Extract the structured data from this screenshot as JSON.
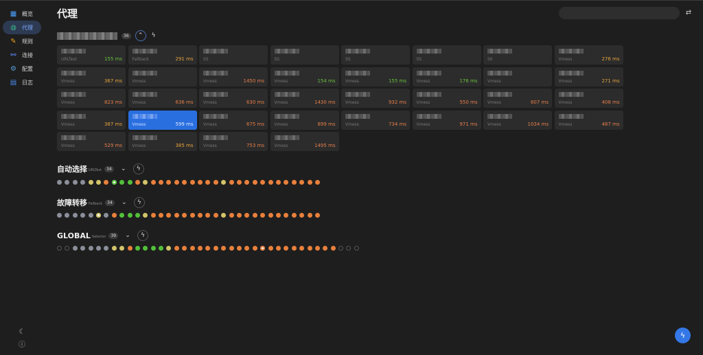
{
  "sidebar": {
    "items": [
      {
        "label": "概览",
        "icon": "chart-icon",
        "glyph": "▦",
        "color": "#4aa3ff"
      },
      {
        "label": "代理",
        "icon": "globe-icon",
        "glyph": "◍",
        "color": "#3bb58a",
        "active": true
      },
      {
        "label": "规则",
        "icon": "pencil-icon",
        "glyph": "✎",
        "color": "#f0a020"
      },
      {
        "label": "连接",
        "icon": "link-icon",
        "glyph": "⚯",
        "color": "#5b8dff"
      },
      {
        "label": "配置",
        "icon": "gear-icon",
        "glyph": "⚙",
        "color": "#5aa0d8"
      },
      {
        "label": "日志",
        "icon": "document-icon",
        "glyph": "▤",
        "color": "#4a8cf0"
      }
    ],
    "theme_glyph": "☾",
    "about_glyph": "ⓘ"
  },
  "header": {
    "title": "代理",
    "settings_glyph": "⇄"
  },
  "main_group": {
    "count": "36",
    "collapse_glyph": "⌃",
    "test_glyph": "ϟ",
    "proxies": [
      {
        "type": "URLTest",
        "delay": "155 ms",
        "tone": "green"
      },
      {
        "type": "Fallback",
        "delay": "291 ms",
        "tone": "orange"
      },
      {
        "type": "SS",
        "delay": "",
        "tone": ""
      },
      {
        "type": "SS",
        "delay": "",
        "tone": ""
      },
      {
        "type": "SS",
        "delay": "",
        "tone": ""
      },
      {
        "type": "SS",
        "delay": "",
        "tone": ""
      },
      {
        "type": "SS",
        "delay": "",
        "tone": ""
      },
      {
        "type": "Vmess",
        "delay": "276 ms",
        "tone": "orange"
      },
      {
        "type": "Vmess",
        "delay": "367 ms",
        "tone": "orange"
      },
      {
        "type": "Vmess",
        "delay": "",
        "tone": ""
      },
      {
        "type": "Vmess",
        "delay": "1450 ms",
        "tone": "red"
      },
      {
        "type": "Vmess",
        "delay": "154 ms",
        "tone": "green"
      },
      {
        "type": "Vmess",
        "delay": "155 ms",
        "tone": "green"
      },
      {
        "type": "Vmess",
        "delay": "176 ms",
        "tone": "green"
      },
      {
        "type": "Vmess",
        "delay": "",
        "tone": ""
      },
      {
        "type": "Vmess",
        "delay": "271 ms",
        "tone": "orange"
      },
      {
        "type": "Vmess",
        "delay": "823 ms",
        "tone": "red"
      },
      {
        "type": "Vmess",
        "delay": "636 ms",
        "tone": "red"
      },
      {
        "type": "Vmess",
        "delay": "630 ms",
        "tone": "red"
      },
      {
        "type": "Vmess",
        "delay": "1430 ms",
        "tone": "red"
      },
      {
        "type": "Vmess",
        "delay": "932 ms",
        "tone": "red"
      },
      {
        "type": "Vmess",
        "delay": "550 ms",
        "tone": "red"
      },
      {
        "type": "Vmess",
        "delay": "607 ms",
        "tone": "red"
      },
      {
        "type": "Vmess",
        "delay": "408 ms",
        "tone": "red"
      },
      {
        "type": "Vmess",
        "delay": "387 ms",
        "tone": "orange"
      },
      {
        "type": "Vmess",
        "delay": "599 ms",
        "tone": "red",
        "selected": true
      },
      {
        "type": "Vmess",
        "delay": "675 ms",
        "tone": "red"
      },
      {
        "type": "Vmess",
        "delay": "899 ms",
        "tone": "red"
      },
      {
        "type": "Vmess",
        "delay": "734 ms",
        "tone": "red"
      },
      {
        "type": "Vmess",
        "delay": "971 ms",
        "tone": "red"
      },
      {
        "type": "Vmess",
        "delay": "1034 ms",
        "tone": "red"
      },
      {
        "type": "Vmess",
        "delay": "487 ms",
        "tone": "red"
      },
      {
        "type": "Vmess",
        "delay": "529 ms",
        "tone": "red"
      },
      {
        "type": "Vmess",
        "delay": "385 ms",
        "tone": "orange"
      },
      {
        "type": "Vmess",
        "delay": "753 ms",
        "tone": "red"
      },
      {
        "type": "Vmess",
        "delay": "1495 ms",
        "tone": "red"
      }
    ]
  },
  "groups": [
    {
      "name": "自动选择",
      "type": "URLTest",
      "count": "34",
      "expand_glyph": "⌄",
      "test_glyph": "ϟ",
      "dots": [
        "gray",
        "gray",
        "gray",
        "gray",
        "yellow",
        "yellow",
        "orange",
        "ring",
        "green",
        "green",
        "orange",
        "yellow",
        "orange",
        "orange",
        "orange",
        "orange",
        "orange",
        "orange",
        "orange",
        "orange",
        "orange",
        "yellow",
        "orange",
        "orange",
        "orange",
        "orange",
        "orange",
        "orange",
        "orange",
        "orange",
        "orange",
        "orange",
        "orange",
        "orange"
      ]
    },
    {
      "name": "故障转移",
      "type": "Fallback",
      "count": "34",
      "expand_glyph": "⌄",
      "test_glyph": "ϟ",
      "dots": [
        "gray",
        "gray",
        "gray",
        "gray",
        "gray",
        "ring-y",
        "gray",
        "orange",
        "green",
        "green",
        "green",
        "yellow",
        "orange",
        "orange",
        "orange",
        "orange",
        "orange",
        "orange",
        "orange",
        "orange",
        "orange",
        "yellow",
        "orange",
        "orange",
        "orange",
        "orange",
        "orange",
        "orange",
        "orange",
        "orange",
        "orange",
        "orange",
        "orange",
        "orange"
      ]
    },
    {
      "name": "GLOBAL",
      "type": "Selector",
      "count": "39",
      "expand_glyph": "⌄",
      "test_glyph": "ϟ",
      "dots": [
        "empty",
        "empty",
        "gray",
        "gray",
        "gray",
        "gray",
        "gray",
        "yellow",
        "yellow",
        "orange",
        "green",
        "green",
        "green",
        "green",
        "yellow",
        "orange",
        "orange",
        "orange",
        "orange",
        "orange",
        "orange",
        "orange",
        "orange",
        "orange",
        "orange",
        "orange",
        "ring-o",
        "orange",
        "orange",
        "orange",
        "orange",
        "orange",
        "orange",
        "orange",
        "orange",
        "orange",
        "empty",
        "empty",
        "empty"
      ]
    }
  ],
  "fab_glyph": "ϟ",
  "colors": {
    "accent": "#3478e8",
    "selected_card": "#2a6fe0",
    "delay_green": "#67c23a",
    "delay_orange": "#e6a23c",
    "delay_red": "#e67e4a"
  }
}
